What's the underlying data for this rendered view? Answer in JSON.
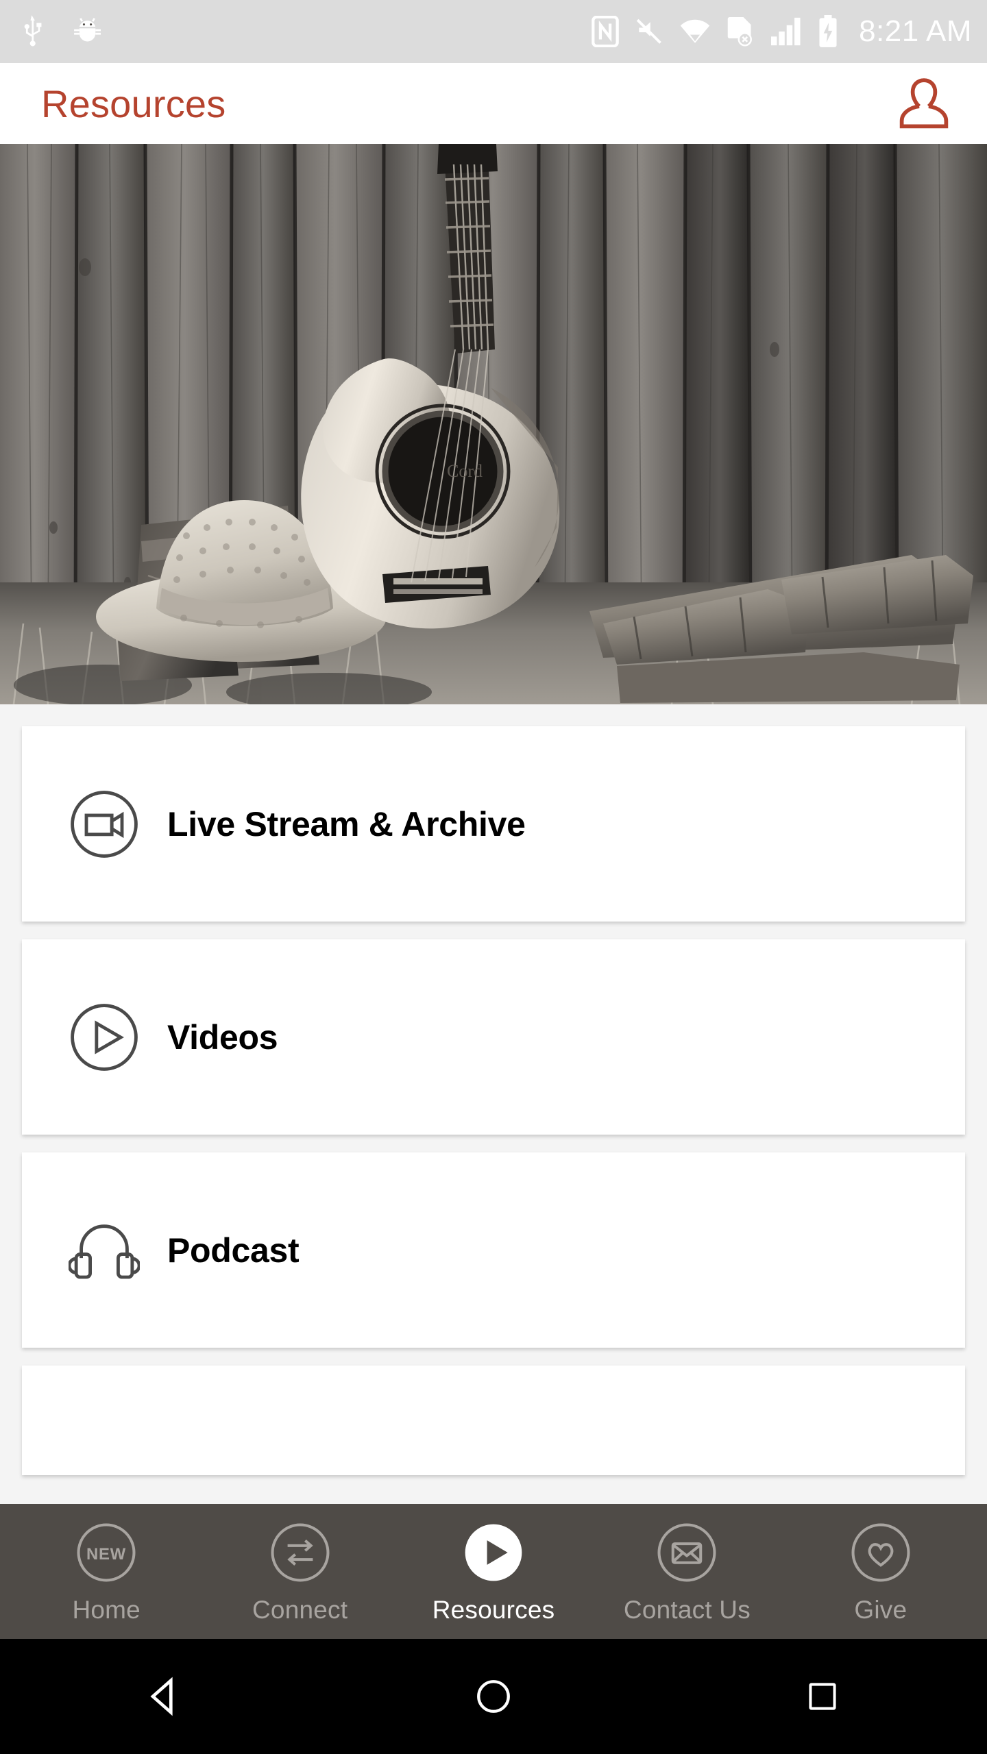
{
  "status_bar": {
    "time": "8:21 AM",
    "background": "#dcdcdc",
    "icon_color": "#ffffff",
    "left_icons": [
      "usb-debugging-icon",
      "android-debug-bug-icon"
    ],
    "right_icons": [
      "nfc-icon",
      "volume-muted-icon",
      "wifi-icon",
      "sim-card-error-icon",
      "cellular-signal-icon",
      "battery-charging-icon"
    ]
  },
  "app_bar": {
    "title": "Resources",
    "title_color": "#b5432e",
    "profile_label": "Profile"
  },
  "hero": {
    "alt": "Black and white photo of an acoustic guitar, straw cowboy hat and boots leaning against a wooden fence with firewood",
    "monochrome": true
  },
  "menu": {
    "items": [
      {
        "label": "Live Stream & Archive",
        "icon": "video-camera-icon"
      },
      {
        "label": "Videos",
        "icon": "play-circle-icon"
      },
      {
        "label": "Podcast",
        "icon": "headphones-icon"
      },
      {
        "label": "",
        "icon": ""
      }
    ]
  },
  "bottom_nav": {
    "background": "#4f4b47",
    "inactive_color": "#a8a4a0",
    "active_color": "#ffffff",
    "items": [
      {
        "label": "Home",
        "icon": "new-badge-circle-icon",
        "badge_text": "NEW",
        "active": false
      },
      {
        "label": "Connect",
        "icon": "exchange-arrows-circle-icon",
        "active": false
      },
      {
        "label": "Resources",
        "icon": "play-filled-circle-icon",
        "active": true
      },
      {
        "label": "Contact Us",
        "icon": "envelope-circle-icon",
        "active": false
      },
      {
        "label": "Give",
        "icon": "heart-circle-icon",
        "active": false
      }
    ]
  },
  "system_nav": {
    "background": "#000000",
    "buttons": [
      {
        "name": "back",
        "icon": "triangle-back-icon"
      },
      {
        "name": "home",
        "icon": "circle-home-icon"
      },
      {
        "name": "recents",
        "icon": "square-recents-icon"
      }
    ]
  }
}
